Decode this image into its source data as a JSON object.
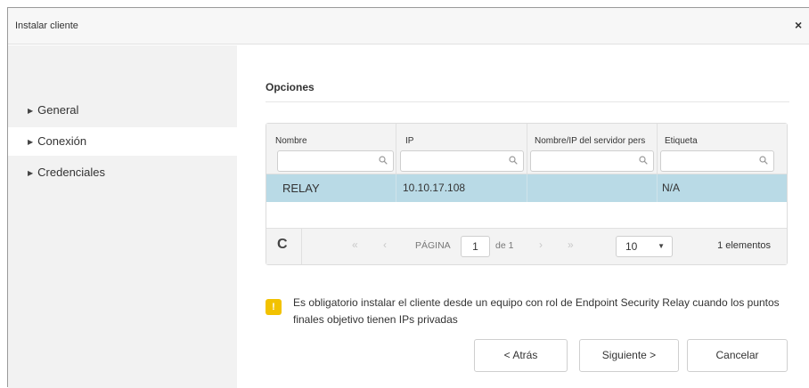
{
  "dialog": {
    "title": "Instalar cliente",
    "close_glyph": "×"
  },
  "sidebar": {
    "items": [
      {
        "label": "General",
        "active": false
      },
      {
        "label": "Conexión",
        "active": true
      },
      {
        "label": "Credenciales",
        "active": false
      }
    ]
  },
  "main": {
    "section_title": "Opciones"
  },
  "table": {
    "columns": [
      "Nombre",
      "IP",
      "Nombre/IP del servidor pers",
      "Etiqueta"
    ],
    "rows": [
      {
        "nombre": "RELAY",
        "ip": "10.10.17.108",
        "servidor": "",
        "etiqueta": "N/A"
      }
    ],
    "selected_row_color": "#b9dae6"
  },
  "pager": {
    "page_label": "PÁGINA",
    "page_value": "1",
    "of_label": "de 1",
    "page_size": "10",
    "count_label": "1 elementos",
    "first_glyph": "«",
    "prev_glyph": "‹",
    "next_glyph": "›",
    "last_glyph": "»",
    "refresh_glyph": "C"
  },
  "warning": {
    "icon": "!",
    "text": "Es obligatorio instalar el cliente desde un equipo con rol de Endpoint Security Relay cuando los puntos finales objetivo tienen IPs privadas",
    "color": "#f2c200"
  },
  "buttons": {
    "back": "< Atrás",
    "next": "Siguiente >",
    "cancel": "Cancelar"
  }
}
